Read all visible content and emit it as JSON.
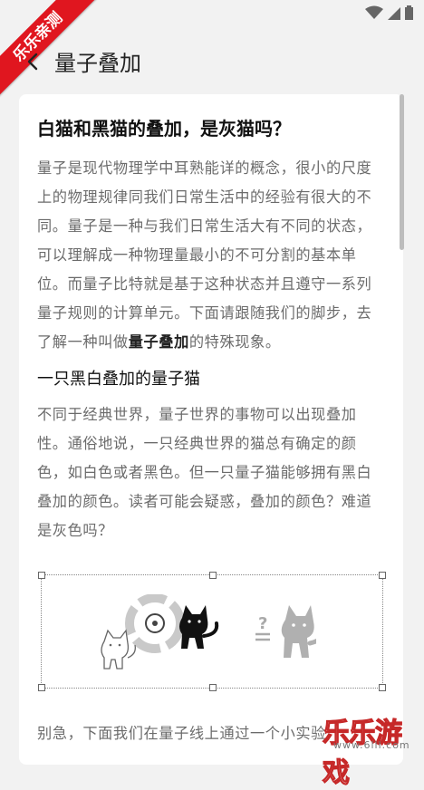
{
  "ribbon_text": "乐乐亲测",
  "appbar": {
    "title": "量子叠加"
  },
  "article": {
    "heading": "白猫和黑猫的叠加，是灰猫吗？",
    "intro_before": "量子是现代物理学中耳熟能详的概念，很小的尺度上的物理规律同我们日常生活中的经验有很大的不同。量子是一种与我们日常生活大有不同的状态，可以理解成一种物理量最小的不可分割的基本单位。而量子比特就是基于这种状态并且遵守一系列量子规则的计算单元。下面请跟随我们的脚步，去了解一种叫做",
    "intro_bold": "量子叠加",
    "intro_after": "的特殊现象。",
    "subheading": "一只黑白叠加的量子猫",
    "body": "不同于经典世界，量子世界的事物可以出现叠加性。通俗地说，一只经典世界的猫总有确定的颜色，如白色或者黑色。但一只量子猫能够拥有黑白叠加的颜色。读者可能会疑惑，叠加的颜色？难道是灰色吗？",
    "figure_question": "?",
    "cutoff_line": "别急，下面我们在量子线上通过一个小实验"
  },
  "watermark": {
    "text": "乐乐游戏",
    "url": "www.6lll.com"
  },
  "colors": {
    "ribbon": "#e0161f",
    "text": "#6b6b6b",
    "heading": "#111111"
  },
  "icons": [
    "wifi-icon",
    "signal-icon",
    "battery-icon",
    "back-arrow-icon",
    "superposition-icon",
    "white-cat-icon",
    "black-cat-icon",
    "gray-cat-icon"
  ]
}
